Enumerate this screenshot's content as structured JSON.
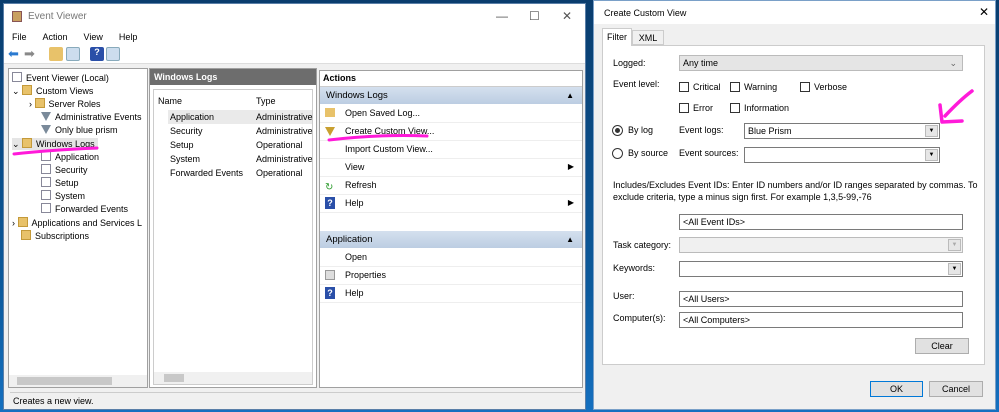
{
  "event_viewer": {
    "title": "Event Viewer",
    "menu": [
      "File",
      "Action",
      "View",
      "Help"
    ],
    "tree": {
      "root": "Event Viewer (Local)",
      "custom_views": "Custom Views",
      "server_roles": "Server Roles",
      "admin_events": "Administrative Events",
      "only_blue_prism": "Only blue prism",
      "windows_logs": "Windows Logs",
      "application": "Application",
      "security": "Security",
      "setup": "Setup",
      "system": "System",
      "forwarded": "Forwarded Events",
      "apps_services": "Applications and Services L",
      "subscriptions": "Subscriptions"
    },
    "middle": {
      "header": "Windows Logs",
      "columns": [
        "Name",
        "Type"
      ],
      "rows": [
        [
          "Application",
          "Administrative"
        ],
        [
          "Security",
          "Administrative"
        ],
        [
          "Setup",
          "Operational"
        ],
        [
          "System",
          "Administrative"
        ],
        [
          "Forwarded Events",
          "Operational"
        ]
      ]
    },
    "actions": {
      "header": "Actions",
      "section1": "Windows Logs",
      "items1": [
        "Open Saved Log...",
        "Create Custom View...",
        "Import Custom View...",
        "View",
        "Refresh",
        "Help"
      ],
      "section2": "Application",
      "items2": [
        "Open",
        "Properties",
        "Help"
      ]
    },
    "status": "Creates a new view."
  },
  "dialog": {
    "title": "Create Custom View",
    "tabs": [
      "Filter",
      "XML"
    ],
    "logged_label": "Logged:",
    "logged_value": "Any time",
    "event_level_label": "Event level:",
    "levels": [
      "Critical",
      "Warning",
      "Verbose",
      "Error",
      "Information"
    ],
    "by_log": "By log",
    "by_source": "By source",
    "event_logs_label": "Event logs:",
    "event_logs_value": "Blue Prism",
    "event_sources_label": "Event sources:",
    "ids_help": "Includes/Excludes Event IDs: Enter ID numbers and/or ID ranges separated by commas. To exclude criteria, type a minus sign first. For example 1,3,5-99,-76",
    "ids_value": "<All Event IDs>",
    "task_category_label": "Task category:",
    "keywords_label": "Keywords:",
    "user_label": "User:",
    "user_value": "<All Users>",
    "computers_label": "Computer(s):",
    "computers_value": "<All Computers>",
    "clear": "Clear",
    "ok": "OK",
    "cancel": "Cancel"
  },
  "colors": {
    "annotation": "#ff1ad9",
    "selection": "#cce4f7"
  }
}
